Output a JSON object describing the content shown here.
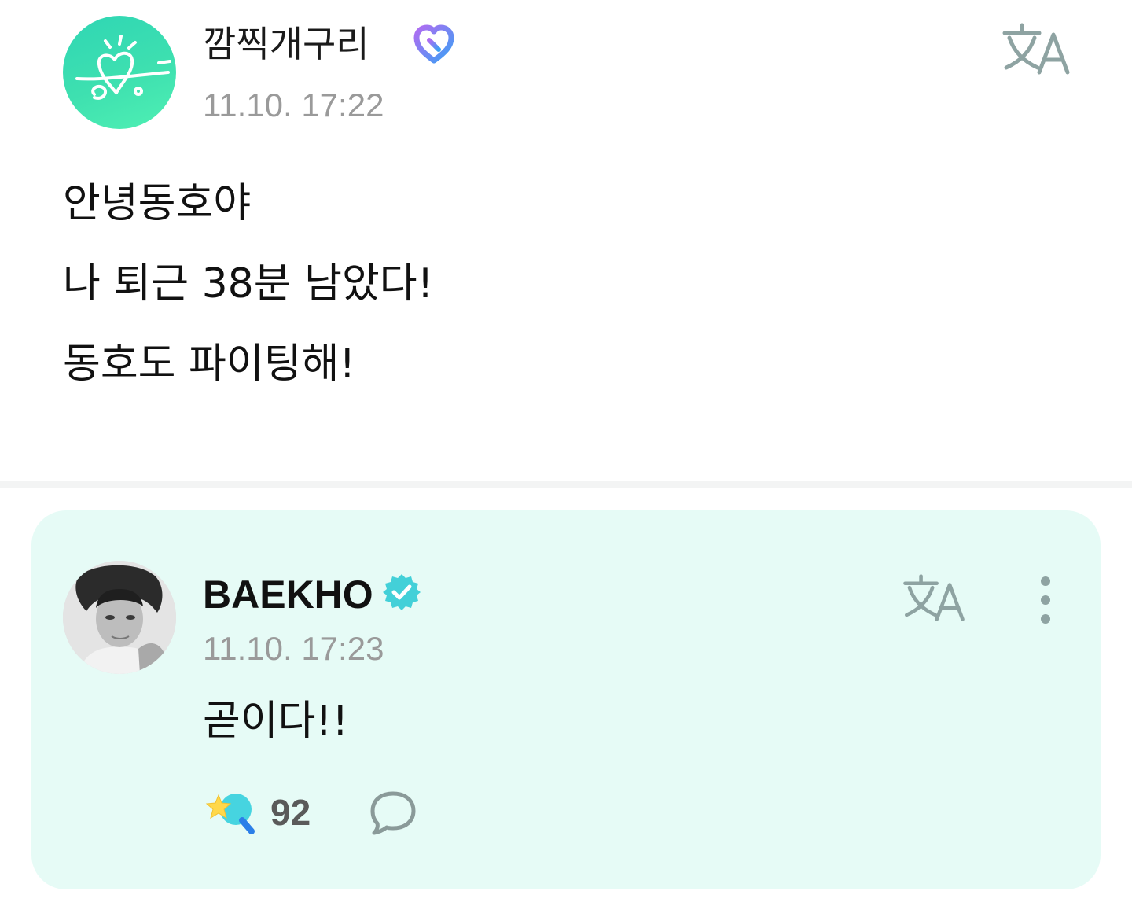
{
  "post": {
    "author_name": "깜찍개구리",
    "timestamp": "11.10. 17:22",
    "lines": [
      "안녕동호야",
      "나 퇴근 38분 남았다!",
      "동호도 파이팅해!"
    ],
    "icons": {
      "avatar": "fan-avatar-heart-logo",
      "badge": "membership-heart-icon",
      "translate": "translate-icon"
    }
  },
  "reply": {
    "author_name": "BAEKHO",
    "timestamp": "11.10. 17:23",
    "text": "곧이다!!",
    "like_count": "92",
    "icons": {
      "avatar": "artist-photo-avatar",
      "badge": "verified-badge-icon",
      "translate": "translate-icon",
      "more": "more-vertical-icon",
      "like": "star-lightstick-like-icon",
      "comment": "comment-bubble-icon"
    }
  },
  "colors": {
    "card_background": "#e6fbf6",
    "accent_teal": "#3dd9c1",
    "verified_badge": "#43d0d8",
    "muted_text": "#9a9a9a",
    "icon_gray": "#8ea3a2"
  }
}
